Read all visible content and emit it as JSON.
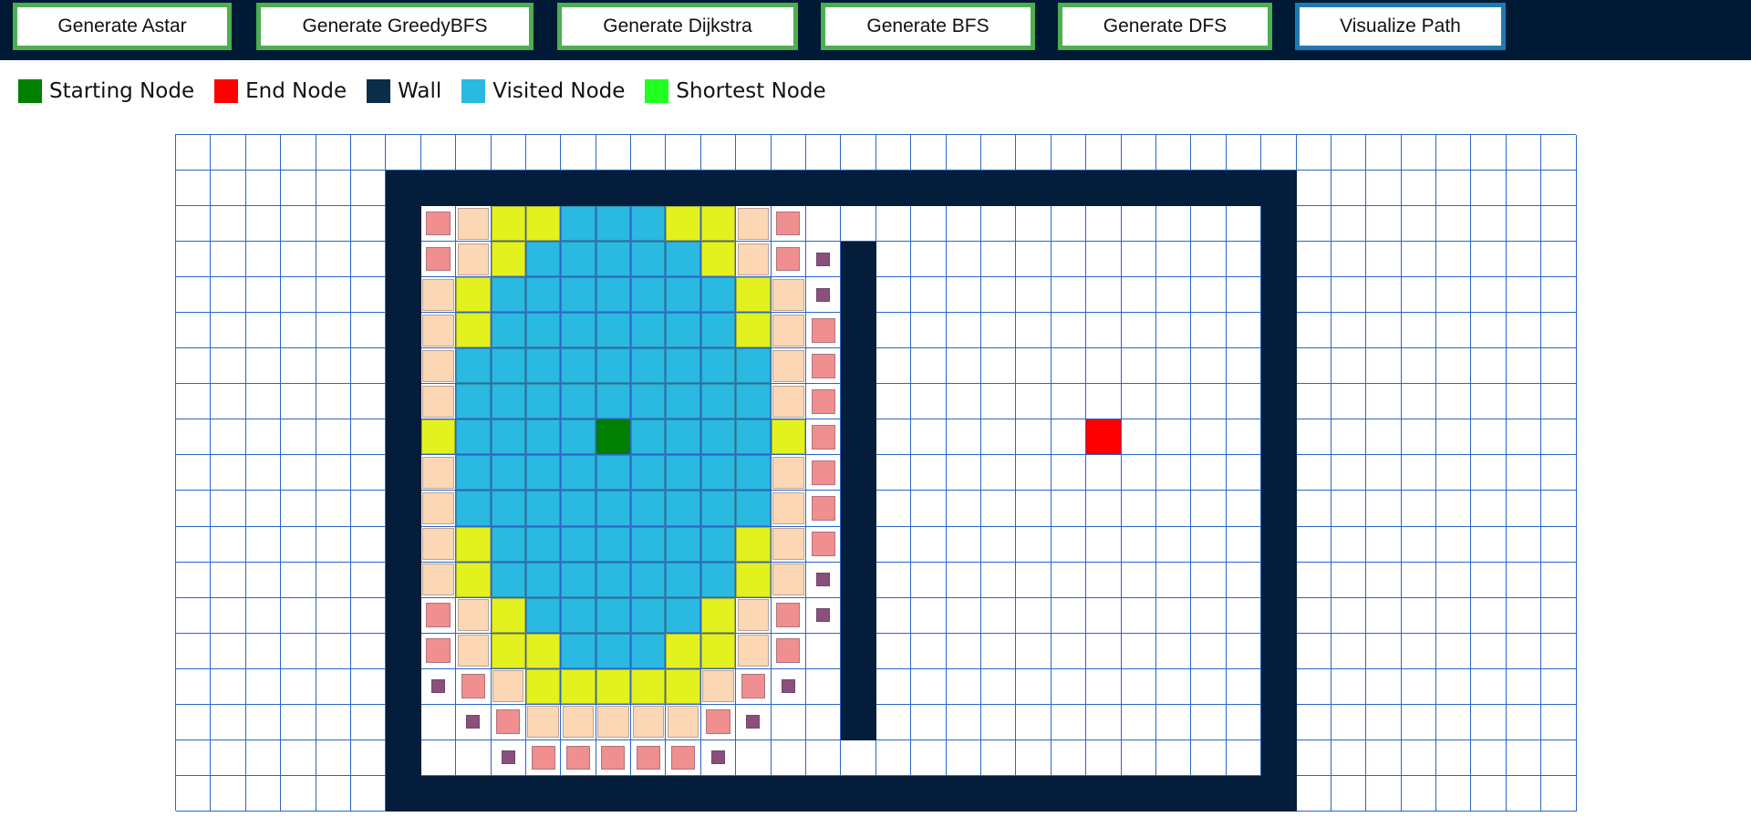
{
  "toolbar": {
    "buttons": [
      {
        "label": "Generate Astar"
      },
      {
        "label": "Generate GreedyBFS"
      },
      {
        "label": "Generate Dijkstra"
      },
      {
        "label": "Generate BFS"
      },
      {
        "label": "Generate DFS"
      },
      {
        "label": "Visualize Path"
      }
    ]
  },
  "legend": [
    {
      "label": "Starting Node",
      "color": "#008000"
    },
    {
      "label": "End Node",
      "color": "#ff0000"
    },
    {
      "label": "Wall",
      "color": "#0b2d48"
    },
    {
      "label": "Visited Node",
      "color": "#29b9e1"
    },
    {
      "label": "Shortest Node",
      "color": "#22ff22"
    }
  ],
  "grid": {
    "cols": 40,
    "rows": 19,
    "start": {
      "row": 8,
      "col": 12
    },
    "end": {
      "row": 8,
      "col": 26
    },
    "walls": {
      "top_row": 1,
      "bottom_row": 18,
      "left_col": 6,
      "right_col": 31,
      "inner_col": 19,
      "inner_rows": [
        3,
        16
      ]
    }
  },
  "colors": {
    "visited": "#29b9e1",
    "frontier_near": "#e3f11f",
    "frontier_mid": "#fcd7b5",
    "frontier_far": "#ef8f8f",
    "frontier_tiny": "#8b4f7b"
  }
}
